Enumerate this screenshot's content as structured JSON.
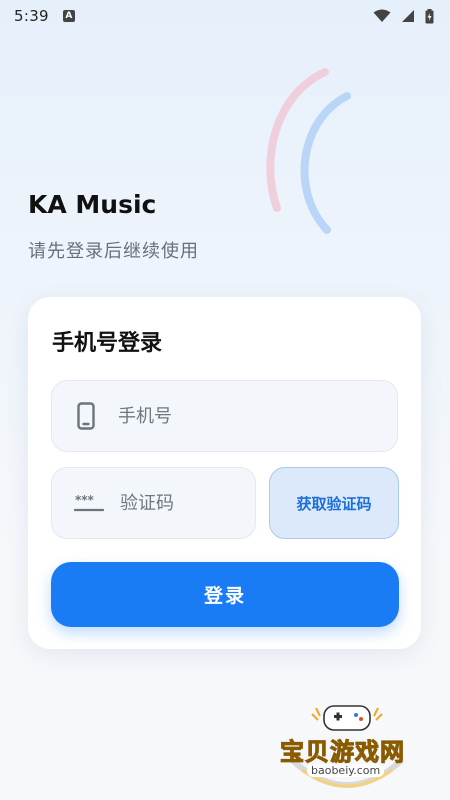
{
  "status_bar": {
    "time": "5:39",
    "notification_icon": "A"
  },
  "app": {
    "title": "KA Music",
    "subtitle": "请先登录后继续使用"
  },
  "login_card": {
    "title": "手机号登录",
    "phone_field": {
      "placeholder": "手机号",
      "value": ""
    },
    "code_field": {
      "placeholder": "验证码",
      "value": ""
    },
    "get_code_label": "获取验证码",
    "login_label": "登录"
  },
  "watermark": {
    "text": "宝贝游戏网",
    "url": "baobeiy.com"
  },
  "colors": {
    "primary": "#1a7cf5",
    "arc_pink": "#f0cfdc",
    "arc_blue": "#b9d6f8"
  }
}
